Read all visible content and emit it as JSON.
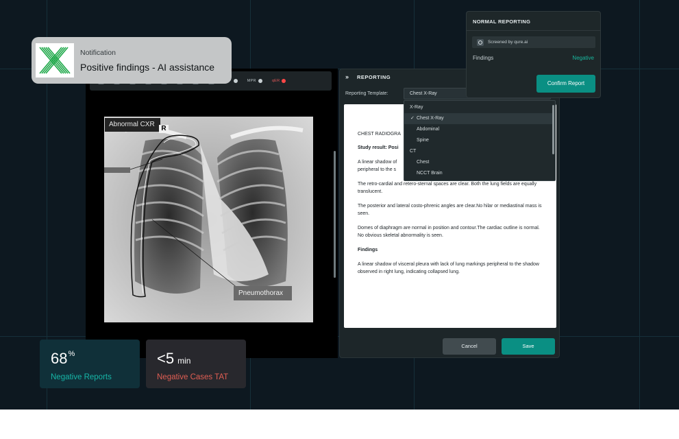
{
  "colors": {
    "background": "#0d1820",
    "accent_teal": "#0a8f83",
    "negative_green": "#19b79e",
    "alert_red": "#e05e53"
  },
  "notification": {
    "label": "Notification",
    "message": "Positive findings - AI assistance",
    "icon": "qure-x-logo-icon"
  },
  "viewer": {
    "toolbar": {
      "mip_label": "MIP",
      "mpr_label": "MPR",
      "qer_label": "qER",
      "icons": [
        "zoom-icon",
        "search-icon",
        "copy-icon",
        "layers-icon",
        "check-icon",
        "rotate-icon",
        "flip-icon",
        "redo-icon"
      ]
    },
    "overlay_labels": {
      "abnormal": "Abnormal CXR",
      "orientation": "R",
      "finding": "Pneumothorax"
    }
  },
  "reporting": {
    "toggle_icon": "»",
    "title": "REPORTING",
    "template_label": "Reporting Template:",
    "template_value": "Chest X-Ray",
    "document": {
      "heading": "CHEST RADIOGRA",
      "study_result": "Study result: Posi",
      "para1": "A linear shadow of",
      "para1b": "peripheral to the s",
      "para2": "The retro-cardial and retero-sternal spaces are clear. Both the lung fields are equally translucent.",
      "para3": "The posterior and lateral costo-phrenic angles are clear.No hilar or mediastinal mass is seen.",
      "para4": "Domes of diaphragm are normal in position and contour.The cardiac outline is normal. No obvious skeletal abnormality is seen.",
      "findings_heading": "Findings",
      "findings_text": "A linear shadow of visceral pleura with lack of lung markings peripheral to the shadow observed in right lung, indicating collapsed lung."
    },
    "cancel_label": "Cancel",
    "save_label": "Save"
  },
  "dropdown": {
    "groups": [
      {
        "label": "X-Ray",
        "options": [
          "Chest X-Ray",
          "Abdominal",
          "Spine"
        ]
      },
      {
        "label": "CT",
        "options": [
          "Chest",
          "NCCT Brain"
        ]
      }
    ],
    "selected": "Chest X-Ray",
    "check_icon": "✓"
  },
  "normal_reporting": {
    "title": "NORMAL REPORTING",
    "search_text": "Screened by qure.ai",
    "findings_label": "Findings",
    "findings_value": "Negative",
    "confirm_label": "Confirm  Report"
  },
  "stats": [
    {
      "value": "68",
      "suffix": "%",
      "label": "Negative Reports"
    },
    {
      "value": "<5",
      "suffix": "min",
      "label": "Negative Cases TAT"
    }
  ]
}
